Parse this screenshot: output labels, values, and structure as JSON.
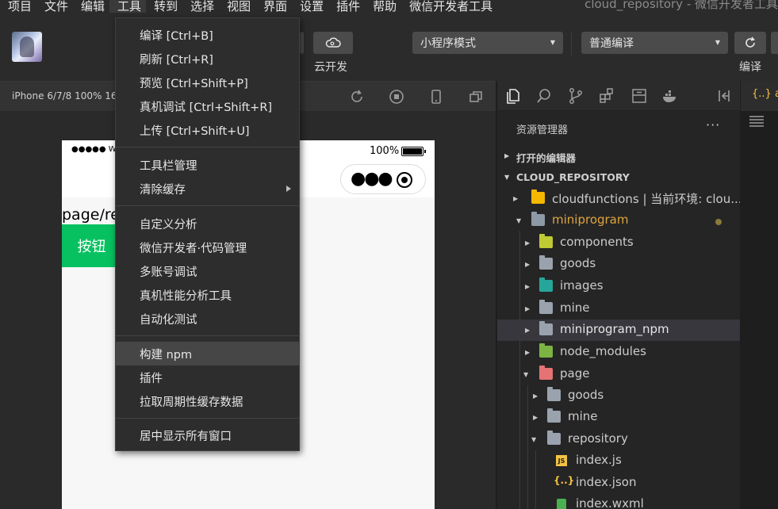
{
  "menubar": {
    "items": [
      "项目",
      "文件",
      "编辑",
      "工具",
      "转到",
      "选择",
      "视图",
      "界面",
      "设置",
      "插件",
      "帮助",
      "微信开发者工具"
    ],
    "window_title": "cloud_repository - 微信开发者工具"
  },
  "toolbar": {
    "cloud_label": "云开发",
    "mode_select": "小程序模式",
    "compile_select": "普通编译",
    "compile_label": "编译"
  },
  "simulator": {
    "device_label": "iPhone 6/7/8 100% 16",
    "status_signal": "●●●●● WeChat",
    "battery_text": "100%",
    "page_path": "page/repository/index",
    "button_label": "按钮"
  },
  "tools_menu": {
    "group1": [
      "编译  [Ctrl+B]",
      "刷新  [Ctrl+R]",
      "预览  [Ctrl+Shift+P]",
      "真机调试  [Ctrl+Shift+R]",
      "上传  [Ctrl+Shift+U]"
    ],
    "group2": [
      "工具栏管理",
      "清除缓存"
    ],
    "group3": [
      "自定义分析",
      "微信开发者·代码管理",
      "多账号调试",
      "真机性能分析工具",
      "自动化测试"
    ],
    "group4": [
      "构建 npm",
      "插件",
      "拉取周期性缓存数据"
    ],
    "group5": [
      "居中显示所有窗口"
    ]
  },
  "explorer": {
    "title": "资源管理器",
    "more": "···",
    "open_editors": "打开的编辑器",
    "project": "CLOUD_REPOSITORY",
    "tree": {
      "cloudfunctions": "cloudfunctions | 当前环境: clou...",
      "miniprogram": "miniprogram",
      "components": "components",
      "goods": "goods",
      "images": "images",
      "mine": "mine",
      "miniprogram_npm": "miniprogram_npm",
      "node_modules": "node_modules",
      "page": "page",
      "page_goods": "goods",
      "page_mine": "mine",
      "repository": "repository",
      "index_js": "index.js",
      "index_json": "index.json",
      "index_wxml": "index.wxml"
    }
  },
  "editor": {
    "tab_label": "{..} a"
  },
  "colors": {
    "accent_green": "#07c160",
    "miniprogram_text": "#e0a53a",
    "js_icon": "#f5c242",
    "json_icon": "#f5c242",
    "wxml_icon": "#4caf50"
  },
  "icons": {
    "open_folder": "folder-open-icon",
    "folder": "folder-icon",
    "cloud": "cloud-icon"
  }
}
